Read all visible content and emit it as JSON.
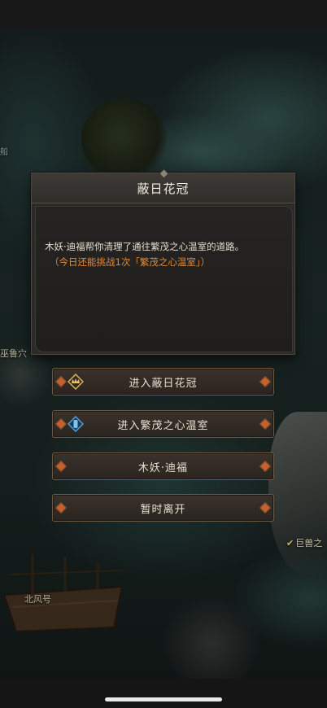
{
  "dialog": {
    "title": "蔽日花冠",
    "message": "木妖·迪福帮你清理了通往繁茂之心温室的道路。",
    "note": "（今日还能挑战1次「繁茂之心温室」）"
  },
  "options": [
    {
      "label": "进入蔽日花冠",
      "icon": "crown-icon"
    },
    {
      "label": "进入繁茂之心温室",
      "icon": "crystal-icon"
    },
    {
      "label": "木妖·迪福",
      "icon": ""
    },
    {
      "label": "暂时离开",
      "icon": ""
    }
  ],
  "map_labels": {
    "left": "巫鲁穴",
    "ship": "北风号",
    "right": "巨兽之",
    "top_left": "船"
  },
  "colors": {
    "accent_orange": "#e08a3a",
    "button_border": "#6d5a43",
    "gem": "#c5602f"
  }
}
